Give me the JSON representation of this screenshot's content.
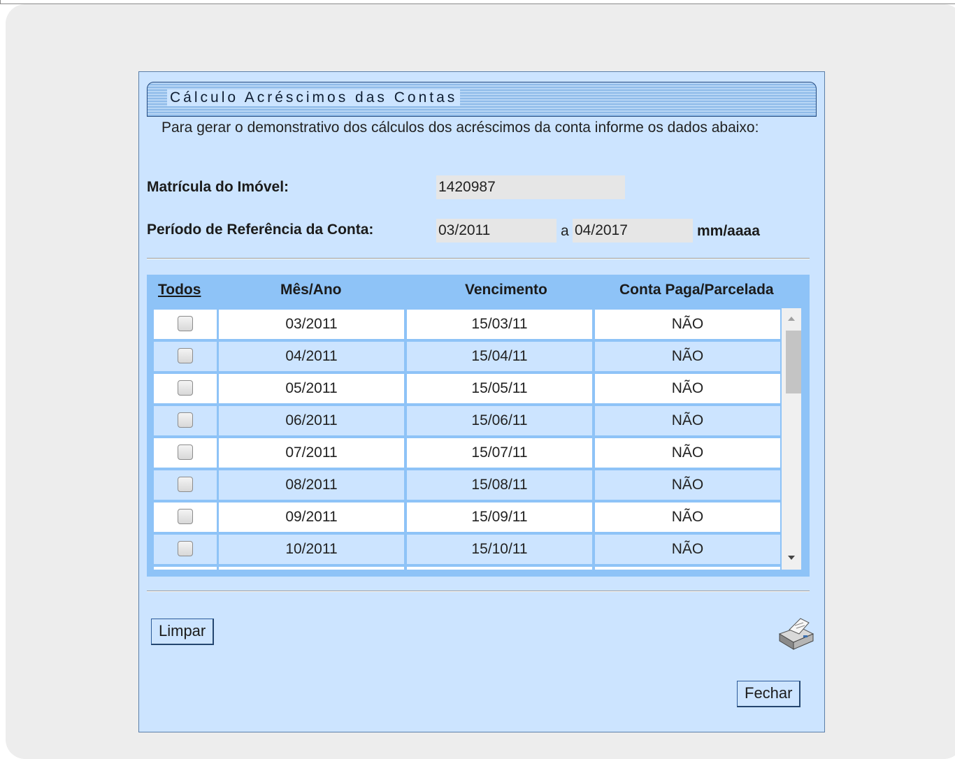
{
  "panel": {
    "title": "Cálculo Acréscimos das Contas",
    "intro": "Para gerar o demonstrativo dos cálculos dos acréscimos da conta informe os dados abaixo:"
  },
  "form": {
    "matricula_label": "Matrícula do Imóvel:",
    "matricula_value": "1420987",
    "periodo_label": "Período de Referência da Conta:",
    "periodo_inicio": "03/2011",
    "periodo_sep": "a",
    "periodo_fim": "04/2017",
    "periodo_format": "mm/aaaa"
  },
  "table": {
    "headers": [
      "Todos",
      "Mês/Ano",
      "Vencimento",
      "Conta Paga/Parcelada"
    ],
    "rows": [
      {
        "mes_ano": "03/2011",
        "vencimento": "15/03/11",
        "paga": "NÃO",
        "checked": false
      },
      {
        "mes_ano": "04/2011",
        "vencimento": "15/04/11",
        "paga": "NÃO",
        "checked": false
      },
      {
        "mes_ano": "05/2011",
        "vencimento": "15/05/11",
        "paga": "NÃO",
        "checked": false
      },
      {
        "mes_ano": "06/2011",
        "vencimento": "15/06/11",
        "paga": "NÃO",
        "checked": false
      },
      {
        "mes_ano": "07/2011",
        "vencimento": "15/07/11",
        "paga": "NÃO",
        "checked": false
      },
      {
        "mes_ano": "08/2011",
        "vencimento": "15/08/11",
        "paga": "NÃO",
        "checked": false
      },
      {
        "mes_ano": "09/2011",
        "vencimento": "15/09/11",
        "paga": "NÃO",
        "checked": false
      },
      {
        "mes_ano": "10/2011",
        "vencimento": "15/10/11",
        "paga": "NÃO",
        "checked": false
      }
    ]
  },
  "buttons": {
    "limpar": "Limpar",
    "fechar": "Fechar",
    "print_icon": "printer-icon"
  },
  "colors": {
    "panel_bg": "#cce4ff",
    "grid_bg": "#8ec3f7",
    "border": "#2c5b99"
  }
}
